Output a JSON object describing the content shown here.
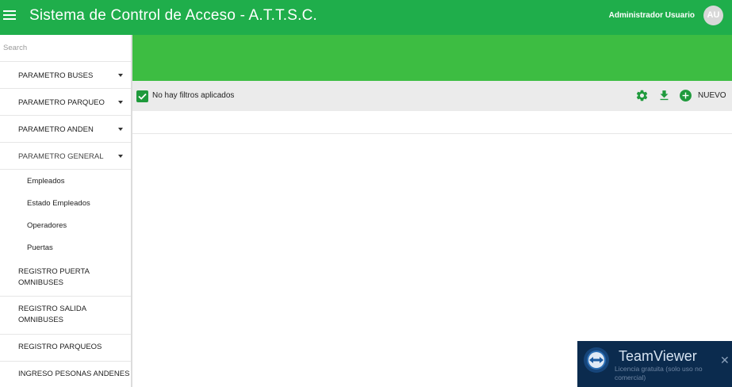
{
  "header": {
    "menu_icon": "hamburger-menu-icon",
    "title": "Sistema de Control de Acceso - A.T.T.S.C.",
    "user_name": "Administrador Usuario",
    "avatar_initials": "AU",
    "bar_color": "#1fae4b"
  },
  "sidebar": {
    "search_placeholder": "Search",
    "items": [
      {
        "label": "PARAMETRO BUSES",
        "expandable": true
      },
      {
        "label": "PARAMETRO PARQUEO",
        "expandable": true
      },
      {
        "label": "PARAMETRO ANDEN",
        "expandable": true
      },
      {
        "label": "PARAMETRO GENERAL",
        "expandable": true,
        "expanded": true
      },
      {
        "label": "REGISTRO PUERTA OMNIBUSES",
        "expandable": false
      },
      {
        "label": "REGISTRO SALIDA OMNIBUSES",
        "expandable": false
      },
      {
        "label": "REGISTRO PARQUEOS",
        "expandable": false
      },
      {
        "label": "INGRESO PESONAS ANDENES",
        "expandable": false
      }
    ],
    "sub_items": [
      "Empleados",
      "Estado Empleados",
      "Operadores",
      "Puertas"
    ]
  },
  "toolbar": {
    "filter_text": "No hay filtros aplicados",
    "settings_icon": "gear-icon",
    "download_icon": "download-icon",
    "add_icon": "plus-circle-icon",
    "new_label": "NUEVO",
    "accent_color": "#1f9a3c",
    "band_color": "#3dbd42"
  },
  "teamviewer": {
    "brand": "TeamViewer",
    "license_text": "Licencia gratuita (solo uso no comercial)",
    "close_icon": "close-icon"
  }
}
